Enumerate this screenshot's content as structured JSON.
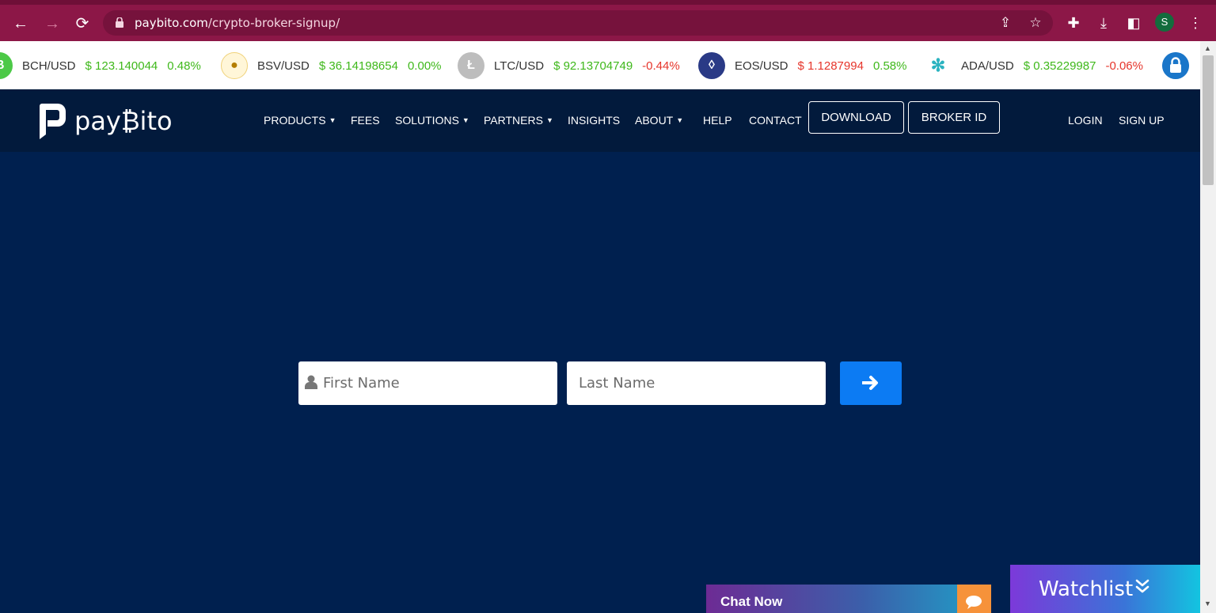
{
  "browser": {
    "url_host": "paybito.com",
    "url_path": "/crypto-broker-signup/",
    "profile_initial": "S"
  },
  "ticker": [
    {
      "pair": "BCH/USD",
      "price": "$ 123.140044",
      "change": "0.48%",
      "direction": "up",
      "icon": "bitcoin-cash-icon",
      "icon_color": "#4cc947"
    },
    {
      "pair": "BSV/USD",
      "price": "$ 36.14198654",
      "change": "0.00%",
      "direction": "up",
      "icon": "bitcoin-sv-icon",
      "icon_color": "#eab300"
    },
    {
      "pair": "LTC/USD",
      "price": "$ 92.13704749",
      "change": "-0.44%",
      "direction": "down",
      "icon": "litecoin-icon",
      "icon_color": "#bdbdbd"
    },
    {
      "pair": "EOS/USD",
      "price": "$ 1.1287994",
      "change": "0.58%",
      "direction": "up",
      "icon": "eos-icon",
      "icon_color": "#2a3a86"
    },
    {
      "pair": "ADA/USD",
      "price": "$ 0.35229987",
      "change": "-0.06%",
      "direction": "down",
      "icon": "cardano-icon",
      "icon_color": "#2bb3c0"
    }
  ],
  "site": {
    "logo_text": "pay₿ito",
    "nav": {
      "products": "PRODUCTS",
      "fees": "FEES",
      "solutions": "SOLUTIONS",
      "partners": "PARTNERS",
      "insights": "INSIGHTS",
      "about": "ABOUT",
      "help": "HELP",
      "contact": "CONTACT",
      "download": "DOWNLOAD",
      "broker_id": "BROKER ID",
      "login": "LOGIN",
      "signup": "SIGN UP"
    }
  },
  "form": {
    "first_name_placeholder": "First Name",
    "last_name_placeholder": "Last Name"
  },
  "widgets": {
    "chat_label": "Chat Now",
    "watchlist_label": "Watchlist"
  },
  "colors": {
    "page_bg": "#00204f",
    "nav_bg": "#021a3c",
    "button_blue": "#0c7bf3",
    "up": "#3fb81b",
    "down": "#e6352b"
  }
}
